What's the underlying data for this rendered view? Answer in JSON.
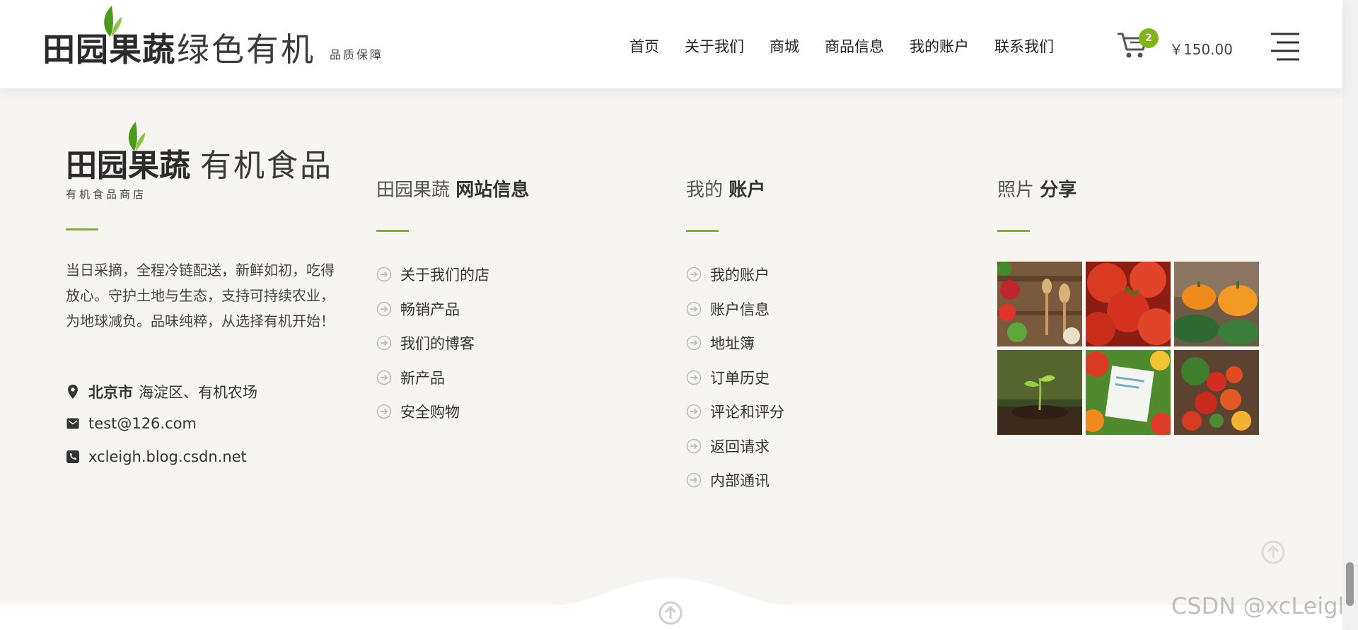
{
  "header": {
    "brand_bold": "田园果蔬",
    "brand_light": "绿色有机",
    "tagline": "品质保障",
    "nav": [
      "首页",
      "关于我们",
      "商城",
      "商品信息",
      "我的账户",
      "联系我们"
    ],
    "cart_count": "2",
    "cart_total": "￥150.00"
  },
  "footer": {
    "brand_bold": "田园果蔬",
    "brand_light": "有机食品",
    "subtitle": "有机食品商店",
    "about": "当日采摘，全程冷链配送，新鲜如初，吃得放心。守护土地与生态，支持可持续农业，为地球减负。品味纯粹，从选择有机开始！",
    "address_city": "北京市",
    "address_rest": "海淀区、有机农场",
    "email": "test@126.com",
    "phone": "xcleigh.blog.csdn.net",
    "col2_light": "田园果蔬 ",
    "col2_bold": "网站信息",
    "col2_links": [
      "关于我们的店",
      "畅销产品",
      "我们的博客",
      "新产品",
      "安全购物"
    ],
    "col3_light": "我的 ",
    "col3_bold": "账户",
    "col3_links": [
      "我的账户",
      "账户信息",
      "地址簿",
      "订单历史",
      "评论和评分",
      "返回请求",
      "内部通讯"
    ],
    "col4_light": "照片 ",
    "col4_bold": "分享"
  },
  "watermark": "CSDN @xcLeigh",
  "colors": {
    "accent": "#7fb61a",
    "background": "#f6f5f2"
  }
}
